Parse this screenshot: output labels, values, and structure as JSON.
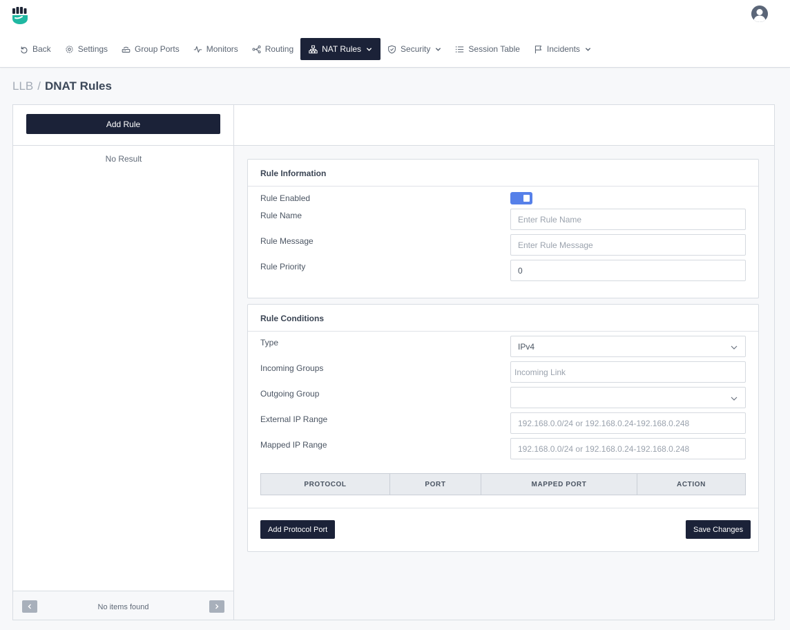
{
  "app": {
    "logo_icon": "shield-fist-logo",
    "brand_color": "#1fb8a2",
    "avatar_icon": "user-avatar-icon"
  },
  "nav": [
    {
      "label": "Back",
      "icon": "undo-icon",
      "active": false,
      "dropdown": false
    },
    {
      "label": "Settings",
      "icon": "gear-icon",
      "active": false,
      "dropdown": false
    },
    {
      "label": "Group Ports",
      "icon": "router-icon",
      "active": false,
      "dropdown": false
    },
    {
      "label": "Monitors",
      "icon": "pulse-icon",
      "active": false,
      "dropdown": false
    },
    {
      "label": "Routing",
      "icon": "network-nodes-icon",
      "active": false,
      "dropdown": false
    },
    {
      "label": "NAT Rules",
      "icon": "sitemap-icon",
      "active": true,
      "dropdown": true
    },
    {
      "label": "Security",
      "icon": "shield-check-icon",
      "active": false,
      "dropdown": true
    },
    {
      "label": "Session Table",
      "icon": "list-icon",
      "active": false,
      "dropdown": false
    },
    {
      "label": "Incidents",
      "icon": "flag-icon",
      "active": false,
      "dropdown": true
    }
  ],
  "breadcrumb": {
    "root": "LLB",
    "separator": "/",
    "current": "DNAT Rules"
  },
  "left_panel": {
    "add_rule_label": "Add Rule",
    "empty_text": "No Result",
    "pagination_text": "No items found"
  },
  "rule_information": {
    "title": "Rule Information",
    "enabled_label": "Rule Enabled",
    "enabled": true,
    "name_label": "Rule Name",
    "name_placeholder": "Enter Rule Name",
    "message_label": "Rule Message",
    "message_placeholder": "Enter Rule Message",
    "priority_label": "Rule Priority",
    "priority_value": "0"
  },
  "rule_conditions": {
    "title": "Rule Conditions",
    "type_label": "Type",
    "type_value": "IPv4",
    "incoming_label": "Incoming Groups",
    "incoming_placeholder": "Incoming Link",
    "outgoing_label": "Outgoing Group",
    "outgoing_value": "",
    "external_label": "External IP Range",
    "external_placeholder": "192.168.0.0/24 or 192.168.0.24-192.168.0.248",
    "mapped_label": "Mapped IP Range",
    "mapped_placeholder": "192.168.0.0/24 or 192.168.0.24-192.168.0.248",
    "table_headers": [
      "PROTOCOL",
      "PORT",
      "MAPPED PORT",
      "ACTION"
    ],
    "add_protocol_label": "Add Protocol Port",
    "save_label": "Save Changes"
  }
}
